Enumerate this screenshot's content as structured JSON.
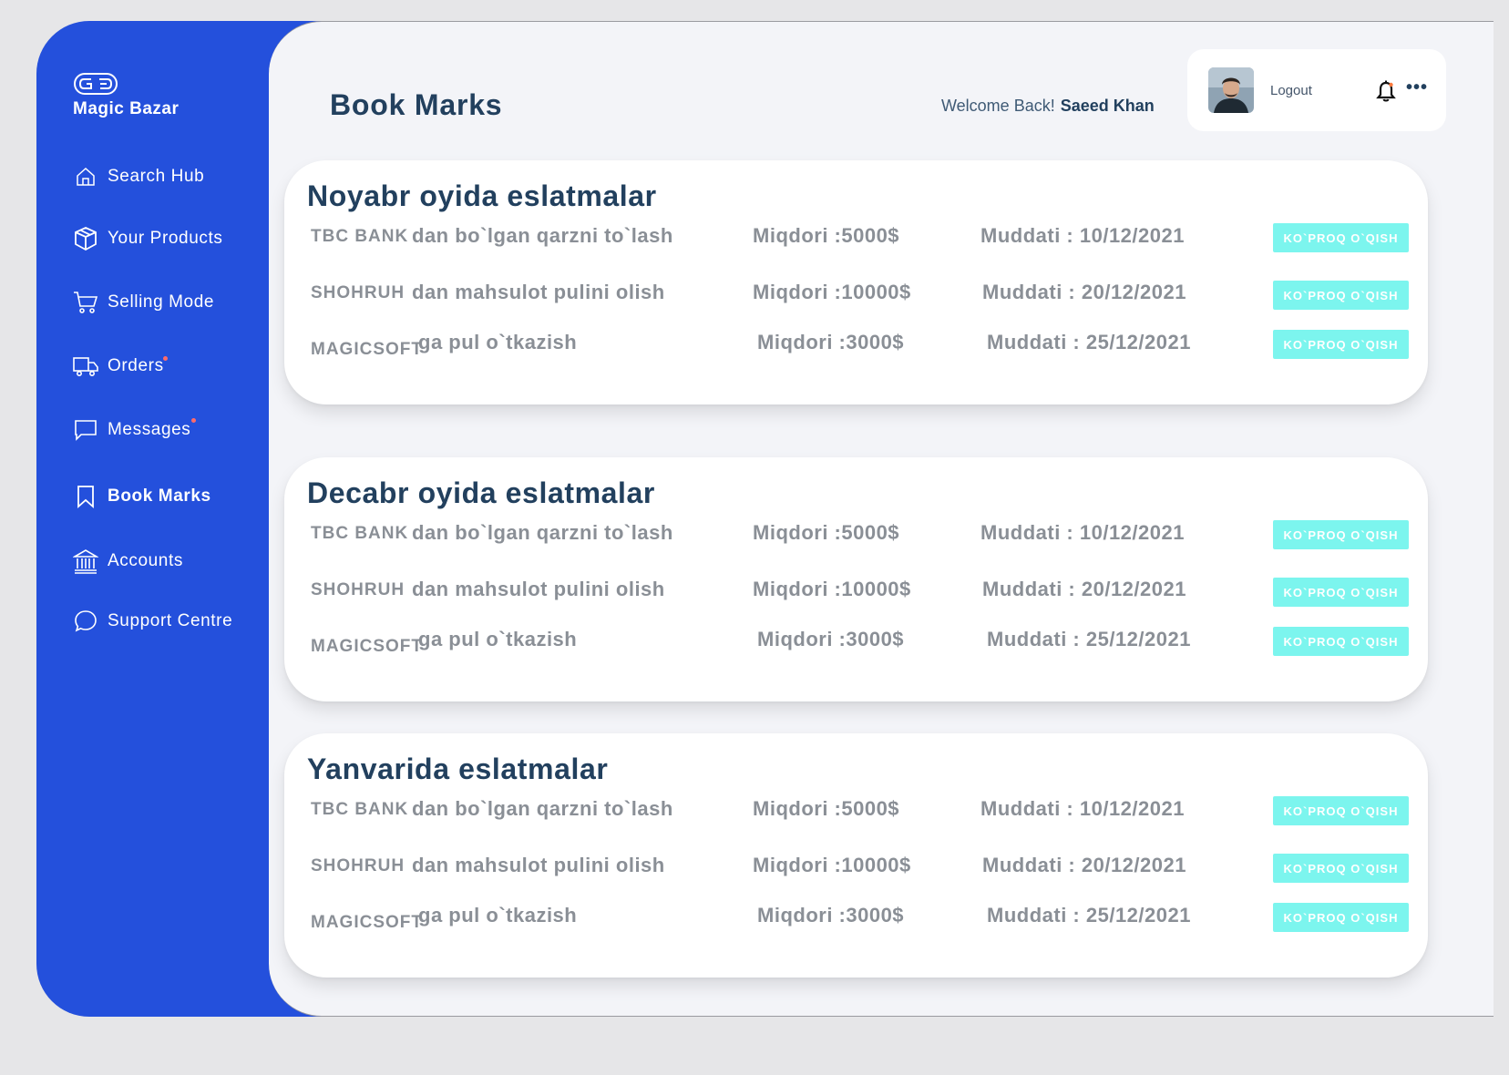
{
  "sidebar": {
    "brand": "Magic Bazar",
    "items": [
      {
        "label": "Search Hub",
        "icon": "home-icon"
      },
      {
        "label": "Your Products",
        "icon": "box-icon"
      },
      {
        "label": "Selling Mode",
        "icon": "cart-icon"
      },
      {
        "label": "Orders",
        "icon": "truck-icon",
        "dot": true
      },
      {
        "label": "Messages",
        "icon": "chat-icon",
        "dot": true
      },
      {
        "label": "Book Marks",
        "icon": "bookmark-icon",
        "active": true
      },
      {
        "label": "Accounts",
        "icon": "bank-icon"
      },
      {
        "label": "Support Centre",
        "icon": "speech-bubble-icon"
      }
    ]
  },
  "header": {
    "title": "Book Marks",
    "welcome": "Welcome Back!",
    "user_name": "Saeed Khan",
    "logout": "Logout",
    "more": "•••"
  },
  "cards": [
    {
      "title": "Noyabr oyida eslatmalar",
      "rows": [
        {
          "who": "TBC BANK",
          "what": "dan bo`lgan qarzni to`lash",
          "amount": "Miqdori :5000$",
          "due": "Muddati : 10/12/2021",
          "button": "KO`PROQ O`QISH"
        },
        {
          "who": "SHOHRUH",
          "what": "dan mahsulot pulini olish",
          "amount": "Miqdori :10000$",
          "due": "Muddati : 20/12/2021",
          "button": "KO`PROQ O`QISH"
        },
        {
          "who": "MAGICSOFT",
          "what": "ga pul o`tkazish",
          "amount": "Miqdori :3000$",
          "due": "Muddati : 25/12/2021",
          "button": "KO`PROQ O`QISH"
        }
      ]
    },
    {
      "title": "Decabr oyida eslatmalar",
      "rows": [
        {
          "who": "TBC BANK",
          "what": "dan bo`lgan qarzni to`lash",
          "amount": "Miqdori :5000$",
          "due": "Muddati : 10/12/2021",
          "button": "KO`PROQ O`QISH"
        },
        {
          "who": "SHOHRUH",
          "what": "dan mahsulot pulini olish",
          "amount": "Miqdori :10000$",
          "due": "Muddati : 20/12/2021",
          "button": "KO`PROQ O`QISH"
        },
        {
          "who": "MAGICSOFT",
          "what": "ga pul o`tkazish",
          "amount": "Miqdori :3000$",
          "due": "Muddati : 25/12/2021",
          "button": "KO`PROQ O`QISH"
        }
      ]
    },
    {
      "title": "Yanvarida eslatmalar",
      "rows": [
        {
          "who": "TBC BANK",
          "what": "dan bo`lgan qarzni to`lash",
          "amount": "Miqdori :5000$",
          "due": "Muddati : 10/12/2021",
          "button": "KO`PROQ O`QISH"
        },
        {
          "who": "SHOHRUH",
          "what": "dan mahsulot pulini olish",
          "amount": "Miqdori :10000$",
          "due": "Muddati : 20/12/2021",
          "button": "KO`PROQ O`QISH"
        },
        {
          "who": "MAGICSOFT",
          "what": "ga pul o`tkazish",
          "amount": "Miqdori :3000$",
          "due": "Muddati : 25/12/2021",
          "button": "KO`PROQ O`QISH"
        }
      ]
    }
  ],
  "colors": {
    "sidebar": "#2450dc",
    "main_bg": "#f3f4f8",
    "title": "#22405e",
    "muted": "#8a8f96",
    "button": "#7cf5ee",
    "notification_dot": "#ff6b6b"
  }
}
